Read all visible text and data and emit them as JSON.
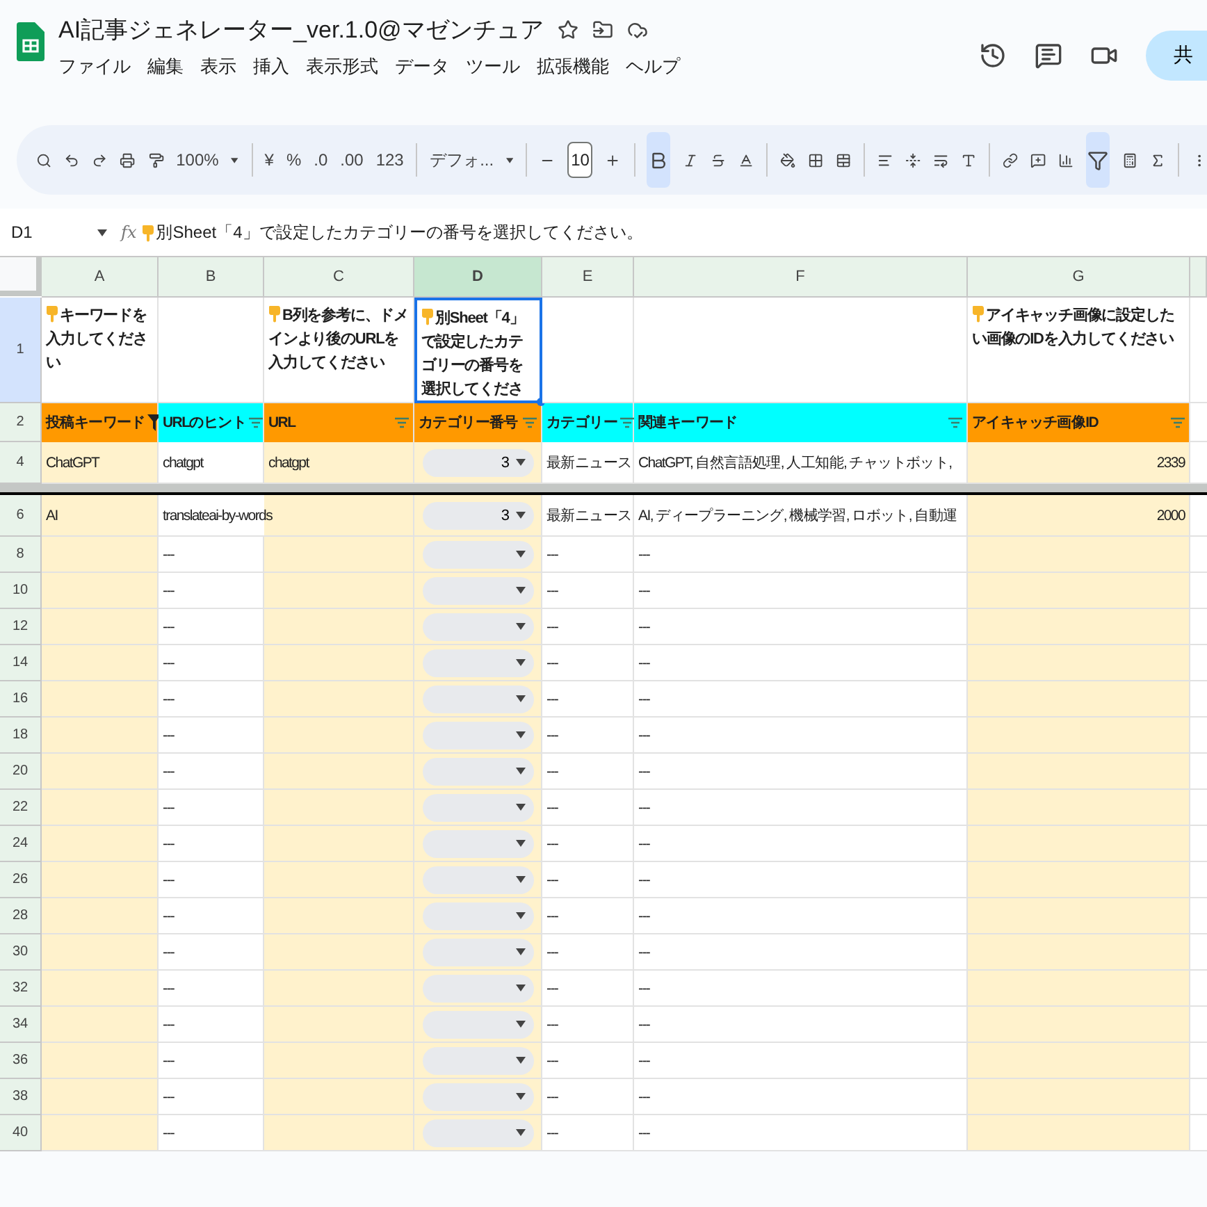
{
  "document": {
    "title": "AI記事ジェネレーター_ver.1.0@マゼンチュア"
  },
  "menu": [
    "ファイル",
    "編集",
    "表示",
    "挿入",
    "表示形式",
    "データ",
    "ツール",
    "拡張機能",
    "ヘルプ"
  ],
  "share": {
    "label": "共"
  },
  "toolbar": {
    "zoom": "100%",
    "currency": "¥",
    "percent": "%",
    "decimal_decrease": ".0",
    "decimal_increase": ".00",
    "number_format": "123",
    "font": "デフォ...",
    "font_size": "10",
    "bold_on": true,
    "filter_on": true
  },
  "formula_bar": {
    "cell_ref": "D1",
    "fx_label": "fx",
    "formula": "別Sheet「4」で設定したカテゴリーの番号を選択してください。"
  },
  "columns": [
    {
      "letter": "A",
      "selected": false
    },
    {
      "letter": "B",
      "selected": false
    },
    {
      "letter": "C",
      "selected": false
    },
    {
      "letter": "D",
      "selected": true
    },
    {
      "letter": "E",
      "selected": false
    },
    {
      "letter": "F",
      "selected": false
    },
    {
      "letter": "G",
      "selected": false
    }
  ],
  "note_row": {
    "number": "1",
    "selected": true,
    "cells": [
      {
        "text": "キーワードを入力してください",
        "selected": false
      },
      {
        "selected": false
      },
      {
        "text": "B列を参考に、ドメインより後のURLを入力してください",
        "selected": false
      },
      {
        "text": "別Sheet「4」で設定したカテゴリーの番号を選択してくださ",
        "selected": true
      },
      {
        "selected": false
      },
      {
        "selected": false
      },
      {
        "text": "アイキャッチ画像に設定したい画像のIDを入力してください",
        "selected": false
      }
    ]
  },
  "header_row": {
    "number": "2",
    "cells": [
      {
        "label": "投稿キーワード",
        "color": "#ff9900",
        "filter_active": true
      },
      {
        "label": "URLのヒント",
        "color": "#00ffff",
        "filter_active": false
      },
      {
        "label": "URL",
        "color": "#ff9900",
        "filter_active": false
      },
      {
        "label": "カテゴリー番号",
        "color": "#ff9900",
        "filter_active": false
      },
      {
        "label": "カテゴリー",
        "color": "#00ffff",
        "filter_active": false
      },
      {
        "label": "関連キーワード",
        "color": "#00ffff",
        "filter_active": false
      },
      {
        "label": "アイキャッチ画像ID",
        "color": "#ff9900",
        "filter_active": false
      }
    ]
  },
  "frozen_rows": [
    {
      "number": "4",
      "A": "ChatGPT",
      "B": "chatgpt",
      "C": "chatgpt",
      "D": "3",
      "E": "最新ニュース",
      "F": "ChatGPT, 自然言語処理, 人工知能, チャットボット,",
      "G": "2339"
    }
  ],
  "rows": [
    {
      "number": "6",
      "A": "AI",
      "B": "translateai-by-words",
      "D": "3",
      "E": "最新ニュース",
      "F": "AI, ディープラーニング, 機械学習, ロボット, 自動運",
      "G": "2000"
    },
    {
      "number": "8",
      "B": "---",
      "E": "---",
      "F": "---"
    },
    {
      "number": "10",
      "B": "---",
      "E": "---",
      "F": "---"
    },
    {
      "number": "12",
      "B": "---",
      "E": "---",
      "F": "---"
    },
    {
      "number": "14",
      "B": "---",
      "E": "---",
      "F": "---"
    },
    {
      "number": "16",
      "B": "---",
      "E": "---",
      "F": "---"
    },
    {
      "number": "18",
      "B": "---",
      "E": "---",
      "F": "---"
    },
    {
      "number": "20",
      "B": "---",
      "E": "---",
      "F": "---"
    },
    {
      "number": "22",
      "B": "---",
      "E": "---",
      "F": "---"
    },
    {
      "number": "24",
      "B": "---",
      "E": "---",
      "F": "---"
    },
    {
      "number": "26",
      "B": "---",
      "E": "---",
      "F": "---"
    },
    {
      "number": "28",
      "B": "---",
      "E": "---",
      "F": "---"
    },
    {
      "number": "30",
      "B": "---",
      "E": "---",
      "F": "---"
    },
    {
      "number": "32",
      "B": "---",
      "E": "---",
      "F": "---"
    },
    {
      "number": "34",
      "B": "---",
      "E": "---",
      "F": "---"
    },
    {
      "number": "36",
      "B": "---",
      "E": "---",
      "F": "---"
    },
    {
      "number": "38",
      "B": "---",
      "E": "---",
      "F": "---"
    },
    {
      "number": "40",
      "B": "---",
      "E": "---",
      "F": "---"
    }
  ]
}
